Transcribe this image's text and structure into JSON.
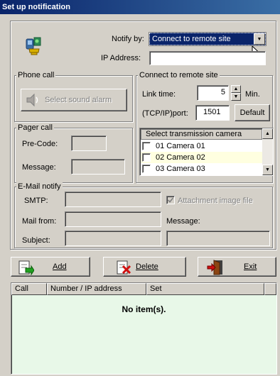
{
  "window": {
    "title": "Set up notification"
  },
  "notify": {
    "notify_by_label": "Notify by:",
    "notify_by_value": "Connect to remote site",
    "ip_label": "IP Address:",
    "ip_value": ""
  },
  "phone_call": {
    "title": "Phone call",
    "sound_button": "Select sound alarm"
  },
  "remote_site": {
    "title": "Connect to remote site",
    "link_time_label": "Link time:",
    "link_time_value": "5",
    "link_time_unit": "Min.",
    "port_label": "(TCP/IP)port:",
    "port_value": "1501",
    "default_button": "Default",
    "camera_header": "Select transmission camera",
    "cameras": [
      {
        "label": "01 Camera 01",
        "checked": false
      },
      {
        "label": "02 Camera 02",
        "checked": false
      },
      {
        "label": "03 Camera 03",
        "checked": false
      }
    ]
  },
  "pager_call": {
    "title": "Pager call",
    "precode_label": "Pre-Code:",
    "message_label": "Message:"
  },
  "email": {
    "title": "E-Mail notify",
    "smtp_label": "SMTP:",
    "mail_from_label": "Mail from:",
    "subject_label": "Subject:",
    "attach_label": "Attachment image file",
    "message_label": "Message:"
  },
  "toolbar": {
    "add_label": "Add",
    "delete_label": "Delete",
    "exit_label": "Exit"
  },
  "list": {
    "columns": [
      "Call",
      "Number / IP address",
      "Set"
    ],
    "empty_text": "No item(s)."
  },
  "colors": {
    "title_bar": "#0a246a",
    "dialog_bg": "#d4d0c8",
    "selection": "#0a246a",
    "list_bg": "#e8f8e8",
    "highlight_row": "#ffffe0"
  }
}
